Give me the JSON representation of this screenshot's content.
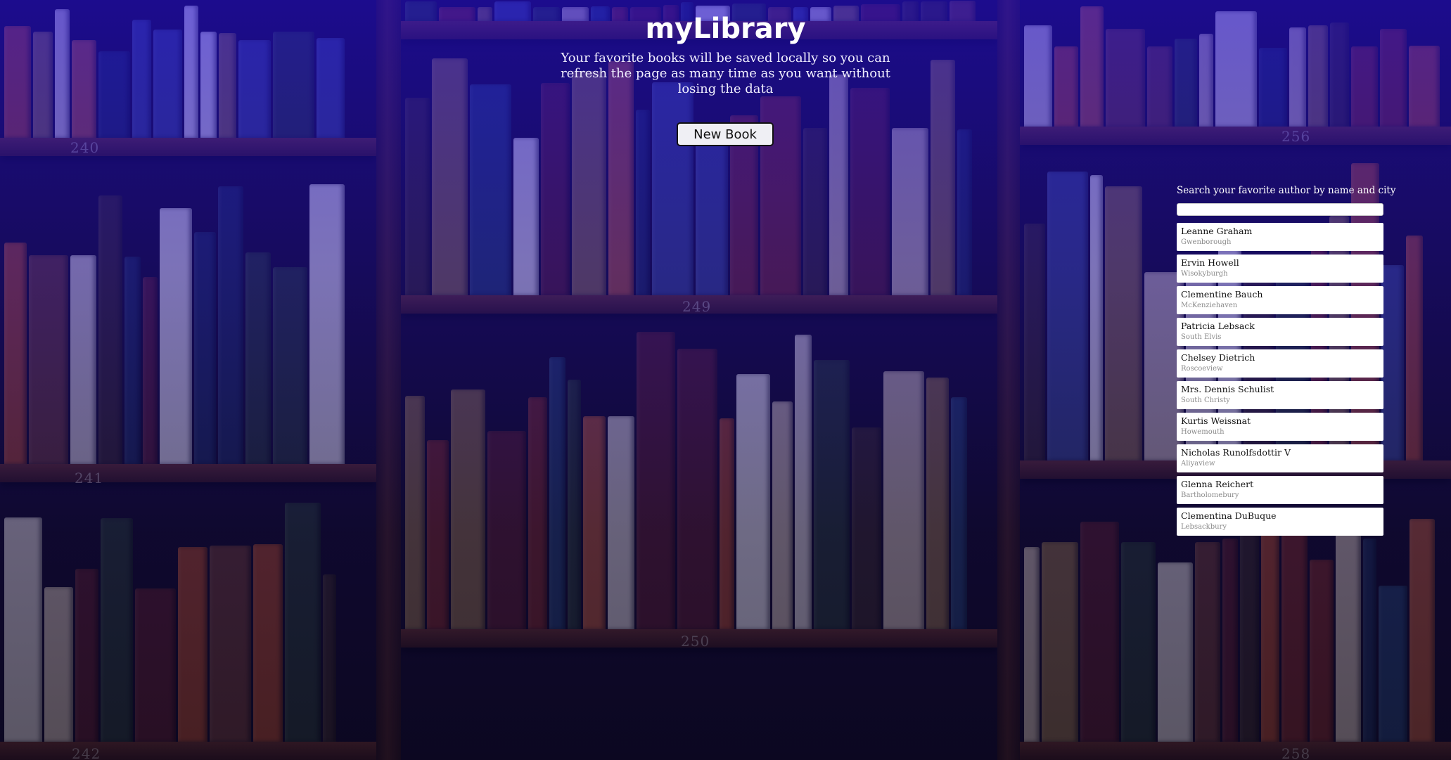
{
  "header": {
    "title": "myLibrary",
    "subtitle": "Your favorite books will be saved locally so you can refresh the page as many time as you want without losing the data"
  },
  "actions": {
    "new_book_label": "New Book"
  },
  "search": {
    "label": "Search your favorite author by name and city",
    "value": ""
  },
  "authors": [
    {
      "name": "Leanne Graham",
      "city": "Gwenborough"
    },
    {
      "name": "Ervin Howell",
      "city": "Wisokyburgh"
    },
    {
      "name": "Clementine Bauch",
      "city": "McKenziehaven"
    },
    {
      "name": "Patricia Lebsack",
      "city": "South Elvis"
    },
    {
      "name": "Chelsey Dietrich",
      "city": "Roscoeview"
    },
    {
      "name": "Mrs. Dennis Schulist",
      "city": "South Christy"
    },
    {
      "name": "Kurtis Weissnat",
      "city": "Howemouth"
    },
    {
      "name": "Nicholas Runolfsdottir V",
      "city": "Aliyaview"
    },
    {
      "name": "Glenna Reichert",
      "city": "Bartholomebury"
    },
    {
      "name": "Clementina DuBuque",
      "city": "Lebsackbury"
    }
  ],
  "background": {
    "shelf_numbers": [
      "240",
      "249",
      "256",
      "241",
      "250",
      "242",
      "258"
    ]
  },
  "colors": {
    "overlay": "#2a10d0",
    "button_bg": "#efeff4",
    "text_light": "#ffffff"
  }
}
